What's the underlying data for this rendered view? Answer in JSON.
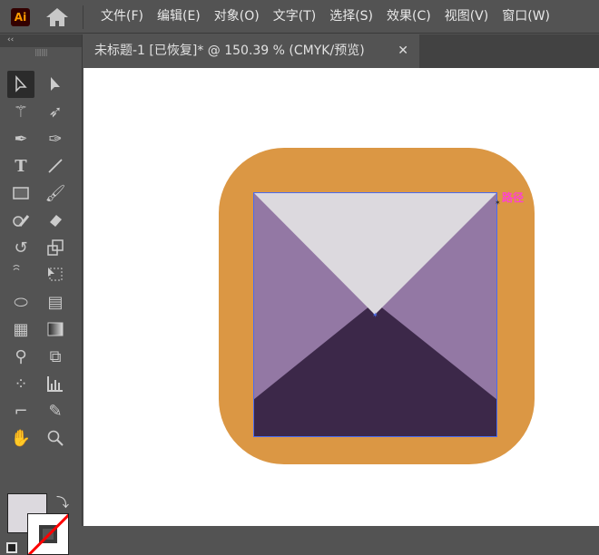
{
  "app": {
    "logo": "Ai"
  },
  "menu": [
    "文件(F)",
    "编辑(E)",
    "对象(O)",
    "文字(T)",
    "选择(S)",
    "效果(C)",
    "视图(V)",
    "窗口(W)"
  ],
  "toolbar": {
    "collapse": "‹‹",
    "grip": "||||||||"
  },
  "document": {
    "tab_title": "未标题-1 [已恢复]* @ 150.39 % (CMYK/预览)",
    "close": "✕"
  },
  "artwork": {
    "hover_label": "路径",
    "colors": {
      "background": "#DB9744",
      "top": "#DCD9DE",
      "sides": "#9378A4",
      "bottom": "#3C2849",
      "selection": "#4a6cf0"
    }
  },
  "colors": {
    "fill": "#DCD9DE",
    "stroke": "none"
  }
}
